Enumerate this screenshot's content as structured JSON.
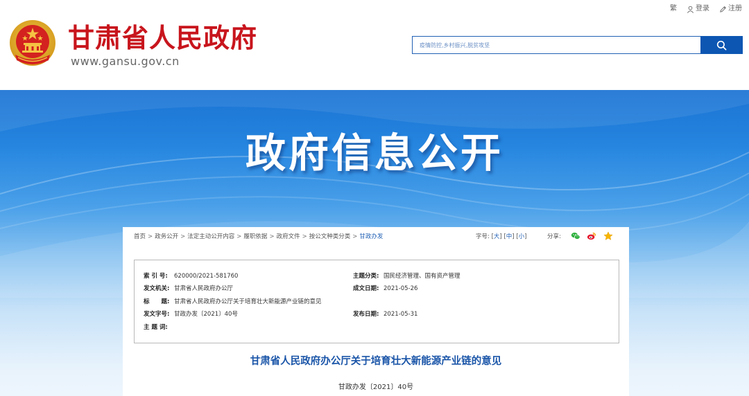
{
  "header": {
    "site_title": "甘肃省人民政府",
    "site_domain": "www.gansu.gov.cn",
    "top_links": {
      "traditional": "繁",
      "login": "登录",
      "register": "注册"
    },
    "search": {
      "placeholder": "疫情防控,乡村振兴,脱贫攻坚"
    }
  },
  "banner": {
    "title": "政府信息公开"
  },
  "breadcrumb": {
    "items": [
      "首页",
      "政务公开",
      "法定主动公开内容",
      "履职依据",
      "政府文件",
      "按公文种类分类",
      "甘政办发"
    ],
    "separator": ">"
  },
  "tools": {
    "font_size_label": "字号:",
    "font_large": "大",
    "font_medium": "中",
    "font_small": "小",
    "share_label": "分享:"
  },
  "meta": {
    "index_label": "索 引 号:",
    "index_value": "620000/2021-581760",
    "issuer_label": "发文机关:",
    "issuer_value": "甘肃省人民政府办公厅",
    "title_label": "标　　题:",
    "title_value": "甘肃省人民政府办公厅关于培育壮大新能源产业链的意见",
    "doc_no_label": "发文字号:",
    "doc_no_value": "甘政办发〔2021〕40号",
    "keywords_label": "主 题 词:",
    "keywords_value": "",
    "topic_label": "主题分类:",
    "topic_value": "国民经济管理、国有资产管理",
    "date_created_label": "成文日期:",
    "date_created_value": "2021-05-26",
    "date_published_label": "发布日期:",
    "date_published_value": "2021-05-31"
  },
  "document": {
    "title": "甘肃省人民政府办公厅关于培育壮大新能源产业链的意见",
    "number": "甘政办发〔2021〕40号"
  },
  "colors": {
    "brand_red": "#c8151d",
    "primary_blue": "#0d56b2",
    "link_blue": "#1f5fb4",
    "emblem_gold": "#f5c343"
  },
  "icons": {
    "emblem": "national-emblem-icon",
    "login": "user-icon",
    "register": "pencil-icon",
    "search": "search-icon",
    "wechat": "wechat-icon",
    "weibo": "weibo-icon",
    "favorite": "star-icon"
  }
}
